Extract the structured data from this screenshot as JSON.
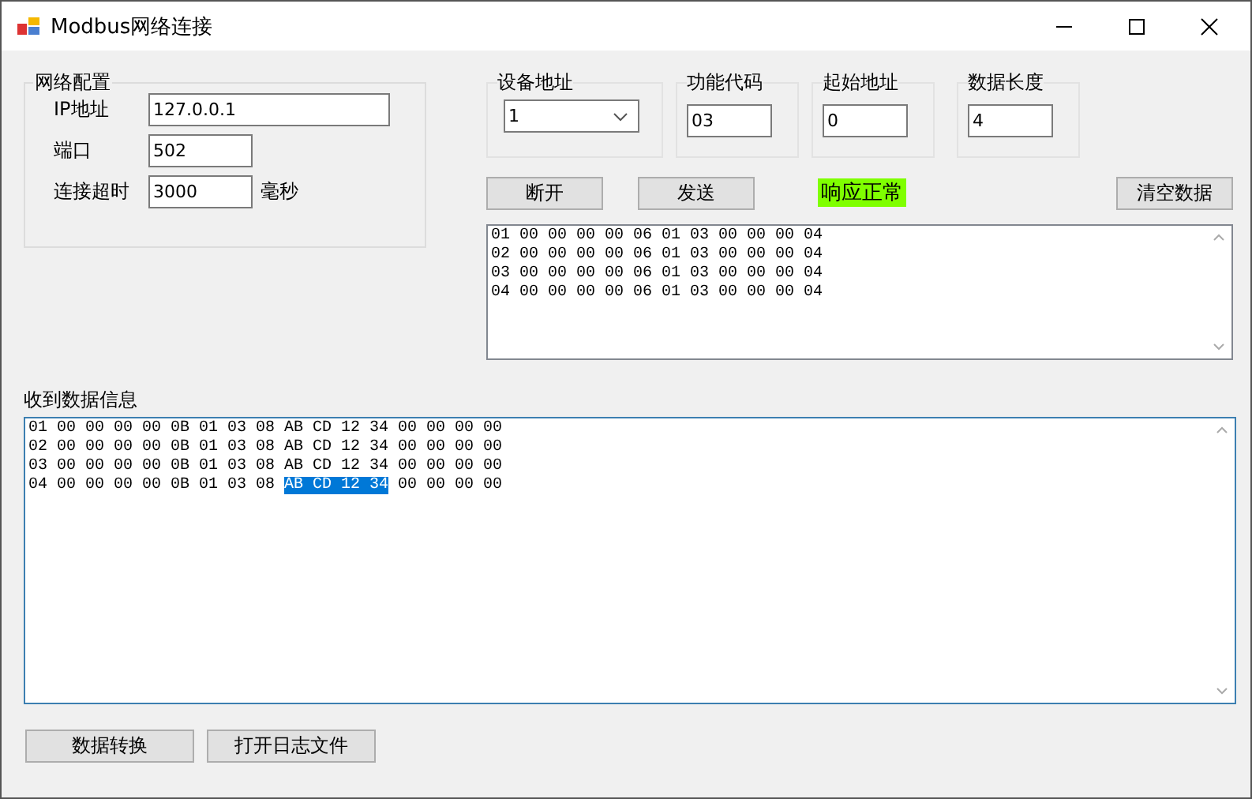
{
  "window": {
    "title": "Modbus网络连接"
  },
  "network_config": {
    "title": "网络配置",
    "fields": [
      {
        "label": "IP地址",
        "value": "127.0.0.1"
      },
      {
        "label": "端口",
        "value": "502"
      },
      {
        "label": "连接超时",
        "value": "3000",
        "unit": "毫秒"
      }
    ]
  },
  "params": [
    {
      "label": "设备地址",
      "value": "1",
      "kind": "dropdown"
    },
    {
      "label": "功能代码",
      "value": "03",
      "kind": "text"
    },
    {
      "label": "起始地址",
      "value": "0",
      "kind": "text"
    },
    {
      "label": "数据长度",
      "value": "4",
      "kind": "text"
    }
  ],
  "actions": {
    "disconnect": "断开",
    "send": "发送",
    "status": "响应正常",
    "clear": "清空数据"
  },
  "sent_data": {
    "lines": [
      "01 00 00 00 00 06 01 03 00 00 00 04",
      "02 00 00 00 00 06 01 03 00 00 00 04",
      "03 00 00 00 00 06 01 03 00 00 00 04",
      "04 00 00 00 00 06 01 03 00 00 00 04"
    ]
  },
  "received": {
    "label": "收到数据信息",
    "lines": [
      [
        {
          "text": "01 00 00 00 00 0B 01 03 08 AB CD 12 34 00 00 00 00",
          "selected": false
        }
      ],
      [
        {
          "text": "02 00 00 00 00 0B 01 03 08 AB CD 12 34 00 00 00 00",
          "selected": false
        }
      ],
      [
        {
          "text": "03 00 00 00 00 0B 01 03 08 AB CD 12 34 00 00 00 00",
          "selected": false
        }
      ],
      [
        {
          "text": "04 00 00 00 00 0B 01 03 08 ",
          "selected": false
        },
        {
          "text": "AB CD 12 34",
          "selected": true
        },
        {
          "text": " 00 00 00 00",
          "selected": false
        }
      ]
    ]
  },
  "bottom_buttons": [
    "数据转换",
    "打开日志文件"
  ]
}
